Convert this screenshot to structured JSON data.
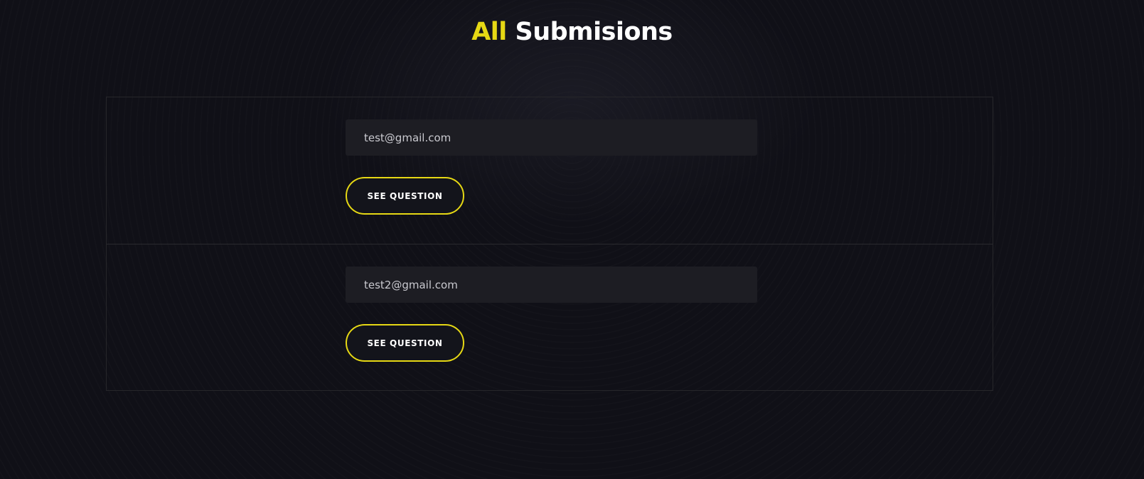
{
  "header": {
    "title_accent": "All",
    "title_main": "Submisions"
  },
  "submissions": [
    {
      "email": "test@gmail.com",
      "button_label": "SEE QUESTION"
    },
    {
      "email": "test2@gmail.com",
      "button_label": "SEE QUESTION"
    }
  ],
  "colors": {
    "background": "#101017",
    "accent": "#e6d814",
    "field_background": "#1d1d23",
    "text": "#ffffff"
  }
}
